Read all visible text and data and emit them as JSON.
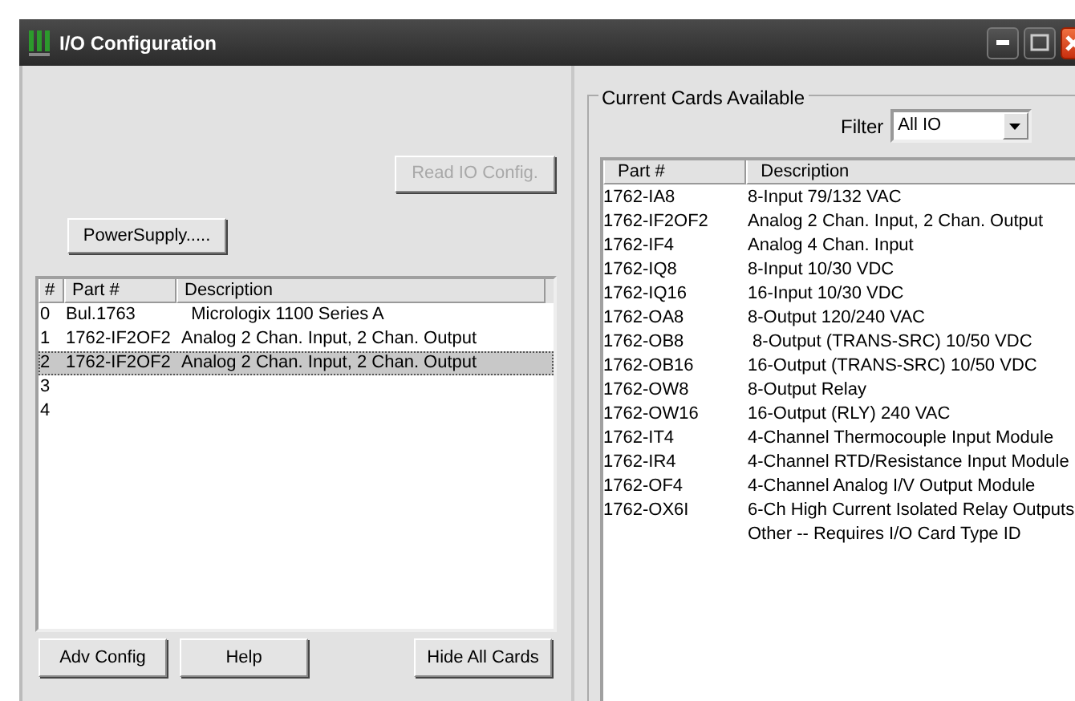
{
  "window": {
    "title": "I/O Configuration"
  },
  "title_buttons": [
    {
      "kind": "minimize"
    },
    {
      "kind": "maximize"
    },
    {
      "kind": "close"
    }
  ],
  "read_button": {
    "label": "Read IO Config.",
    "disabled": true
  },
  "power_button": {
    "label": "PowerSupply.....",
    "disabled": false
  },
  "config_table": {
    "columns": [
      "#",
      "Part #",
      "Description"
    ],
    "rows": [
      {
        "slot": "0",
        "part": "Bul.1763",
        "description": "  Micrologix 1100 Series A",
        "selected": false
      },
      {
        "slot": "1",
        "part": "1762-IF2OF2",
        "description": "Analog 2 Chan. Input, 2 Chan. Output",
        "selected": false
      },
      {
        "slot": "2",
        "part": "1762-IF2OF2",
        "description": "Analog 2 Chan. Input, 2 Chan. Output",
        "selected": true
      },
      {
        "slot": "3",
        "selected": false
      },
      {
        "slot": "4",
        "selected": false
      }
    ]
  },
  "bottom_buttons": [
    {
      "label": "Adv Config"
    },
    {
      "label": "Help"
    },
    {
      "label": "Hide All Cards"
    }
  ],
  "cards_group": {
    "title": "Current Cards Available",
    "filter": {
      "label": "Filter",
      "value": "All IO"
    },
    "columns": [
      "Part #",
      "Description"
    ],
    "rows": [
      {
        "part": "1762-IA8",
        "description": "8-Input 79/132 VAC"
      },
      {
        "part": "1762-IF2OF2",
        "description": "Analog 2 Chan. Input, 2 Chan. Output"
      },
      {
        "part": "1762-IF4",
        "description": "Analog 4 Chan. Input"
      },
      {
        "part": "1762-IQ8",
        "description": "8-Input 10/30 VDC"
      },
      {
        "part": "1762-IQ16",
        "description": "16-Input 10/30 VDC"
      },
      {
        "part": "1762-OA8",
        "description": "8-Output 120/240 VAC"
      },
      {
        "part": "1762-OB8",
        "description": " 8-Output (TRANS-SRC) 10/50 VDC"
      },
      {
        "part": "1762-OB16",
        "description": "16-Output (TRANS-SRC) 10/50 VDC"
      },
      {
        "part": "1762-OW8",
        "description": "8-Output Relay"
      },
      {
        "part": "1762-OW16",
        "description": "16-Output (RLY) 240 VAC"
      },
      {
        "part": "1762-IT4",
        "description": "4-Channel Thermocouple Input Module"
      },
      {
        "part": "1762-IR4",
        "description": "4-Channel RTD/Resistance Input Module"
      },
      {
        "part": "1762-OF4",
        "description": "4-Channel Analog I/V Output Module"
      },
      {
        "part": "1762-OX6I",
        "description": "6-Ch High Current Isolated Relay Outputs"
      },
      {
        "description": "Other -- Requires I/O Card Type ID"
      }
    ]
  }
}
